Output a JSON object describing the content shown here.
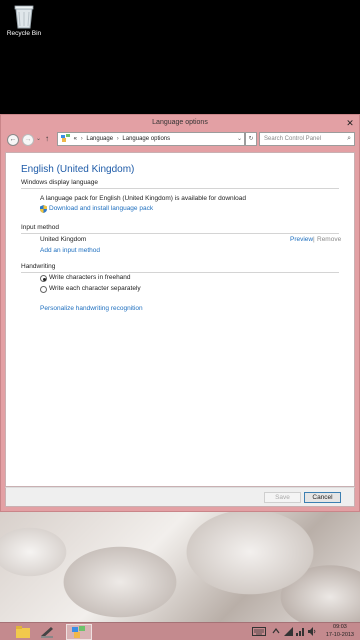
{
  "desktop": {
    "recycle_bin_label": "Recycle Bin"
  },
  "window": {
    "title": "Language options",
    "close_glyph": "✕"
  },
  "address_bar": {
    "back_glyph": "←",
    "forward_glyph": "→",
    "up_glyph": "↑",
    "prefix": "«",
    "crumbs": [
      "Language",
      "Language options"
    ],
    "separator": "›",
    "refresh_glyph": "↻",
    "dropdown_glyph": "⌄",
    "search_placeholder": "Search Control Panel",
    "search_glyph": "⌕"
  },
  "content": {
    "heading": "English (United Kingdom)",
    "display_language": {
      "section_title": "Windows display language",
      "message": "A language pack for English (United Kingdom) is available for download",
      "download_link": "Download and install language pack"
    },
    "input_method": {
      "section_title": "Input method",
      "method_name": "United Kingdom",
      "preview_link": "Preview",
      "divider": "|",
      "remove_link": "Remove",
      "add_link": "Add an input method"
    },
    "handwriting": {
      "section_title": "Handwriting",
      "options": [
        {
          "label": "Write characters in freehand",
          "selected": true
        },
        {
          "label": "Write each character separately",
          "selected": false
        }
      ],
      "personalize_link": "Personalize handwriting recognition"
    }
  },
  "buttons": {
    "save": "Save",
    "cancel": "Cancel"
  },
  "taskbar": {
    "tray_icons": [
      "keyboard-icon",
      "chevron-up-icon",
      "signal-icon",
      "network-icon",
      "volume-icon"
    ],
    "time": "09:03",
    "date": "17-10-2013"
  },
  "colors": {
    "window_frame": "#e3a0a4",
    "accent_link": "#1e6fbf",
    "heading": "#1e5ba8",
    "taskbar": "#c48a8e"
  }
}
